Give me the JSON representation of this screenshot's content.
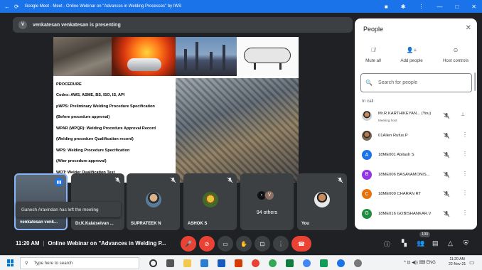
{
  "browser": {
    "back": "←",
    "reload": "⟳",
    "tab_title": "Google Meet - Meet - Online Webinar on \"Advances in Welding Processes\" by IWS",
    "right_icons": [
      "■",
      "✱",
      "⋮",
      "—",
      "□",
      "✕"
    ]
  },
  "stage": {
    "presenting_initial": "V",
    "presenting_text": "venkatesan venkatesan is presenting"
  },
  "slide": {
    "points": [
      "PROCEDURE",
      "Codes: AWS, ASME, BS, ISO, IS, API",
      "pWPS: Preliminary Welding Procedure Specification",
      "(Before procedure approval)",
      "WPAR (WPQR): Welding Procedure Approval Record",
      "(Welding procedure Qualification record)",
      "WPS: Welding Procedure Specification",
      "(After procedure approval)",
      "WQT: Welder Qualification Test"
    ]
  },
  "tiles": {
    "t1_name": "venkatesan venk...",
    "t2_name": "Dr.K.Kalaiselvan ...",
    "t3_name": "SUPRATEEK N",
    "t4_name": "ASHOK S",
    "t5_count": "94 others",
    "t5_avatar_a": "V",
    "t6_name": "You"
  },
  "toast": "Ganesh Aravindan has left the meeting",
  "people_panel": {
    "title": "People",
    "actions": [
      "Mute all",
      "Add people",
      "Host controls"
    ],
    "search_placeholder": "Search for people",
    "section": "In call",
    "participants": [
      {
        "name": "Mr.R.KARTHIKEYAN... (You)",
        "sub": "Meeting host",
        "initial": "",
        "color": "#8d6e63"
      },
      {
        "name": "01Allen Rufus.P",
        "initial": "",
        "color": "#6d4c41"
      },
      {
        "name": "18ME001 Abilash S",
        "initial": "A",
        "color": "#1a73e8"
      },
      {
        "name": "18ME006 BASAVAMONIS...",
        "initial": "B",
        "color": "#9334e6"
      },
      {
        "name": "18ME009 CHARAN RT",
        "initial": "C",
        "color": "#e8710a"
      },
      {
        "name": "18ME016 GOBISHANKAR.V",
        "initial": "G",
        "color": "#1e8e3e"
      }
    ]
  },
  "controls": {
    "time": "11:20 AM",
    "meeting_title": "Online Webinar on \"Advances in Welding P...",
    "people_count": "100"
  },
  "taskbar": {
    "search_placeholder": "Type here to search",
    "tray": "^ ⊡ ◀)) ⌨ ENG",
    "time": "11:20 AM",
    "date": "22-Nov-21"
  }
}
